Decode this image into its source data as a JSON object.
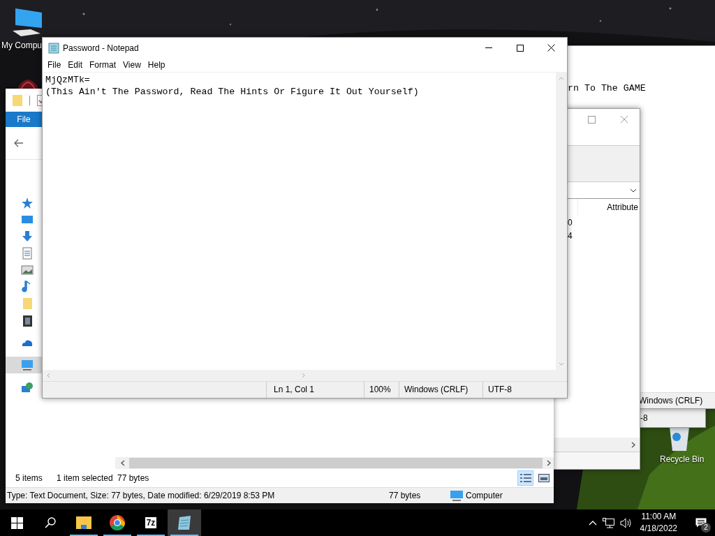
{
  "desktop_icons": [
    {
      "kind": "computer",
      "label": "My Compu"
    },
    {
      "kind": "app"
    },
    {
      "kind": "recycle",
      "label": "Recycle Bin"
    }
  ],
  "back_window": {
    "status": "-8"
  },
  "back_notepad": {
    "line": "rn To The GAME",
    "status": "Windows (CRLF)"
  },
  "properties_window": {
    "column": "Attribute",
    "rows": [
      "0",
      "4"
    ]
  },
  "explorer": {
    "ribbon_tab": "File",
    "nav_items": [
      {
        "kind": "star",
        "selected": false
      },
      {
        "kind": "desktop",
        "selected": false
      },
      {
        "kind": "download",
        "selected": false
      },
      {
        "kind": "document",
        "selected": false
      },
      {
        "kind": "picture",
        "selected": false
      },
      {
        "kind": "music",
        "selected": false
      },
      {
        "kind": "folder",
        "selected": false
      },
      {
        "kind": "video",
        "selected": false
      },
      {
        "kind": "cloud",
        "selected": false
      },
      {
        "kind": "pc",
        "selected": true
      },
      {
        "kind": "network",
        "selected": false
      }
    ],
    "status": [
      "5 items",
      "1 item selected",
      "77 bytes"
    ],
    "view_buttons": [
      {
        "kind": "details",
        "selected": true
      },
      {
        "kind": "preview",
        "selected": false
      }
    ],
    "details_bar": {
      "text": "Type: Text Document, Size: 77 bytes, Date modified: 6/29/2019 8:53 PM",
      "size": "77 bytes",
      "location": "Computer"
    }
  },
  "notepad": {
    "title": "Password - Notepad",
    "menu": [
      "File",
      "Edit",
      "Format",
      "View",
      "Help"
    ],
    "lines": [
      "MjQzMTk=",
      "(This Ain't The Password, Read The Hints Or Figure It Out Yourself)"
    ],
    "status": [
      "Ln 1, Col 1",
      "100%",
      "Windows (CRLF)",
      "UTF-8"
    ]
  },
  "taskbar": {
    "apps": [
      {
        "kind": "explorer",
        "selected": false
      },
      {
        "kind": "chrome",
        "selected": false
      },
      {
        "kind": "archiver",
        "label": "7z",
        "selected": false
      },
      {
        "kind": "notepad",
        "selected": true
      }
    ],
    "time": "11:00 AM",
    "date": "4/18/2022",
    "notifications": "2"
  }
}
